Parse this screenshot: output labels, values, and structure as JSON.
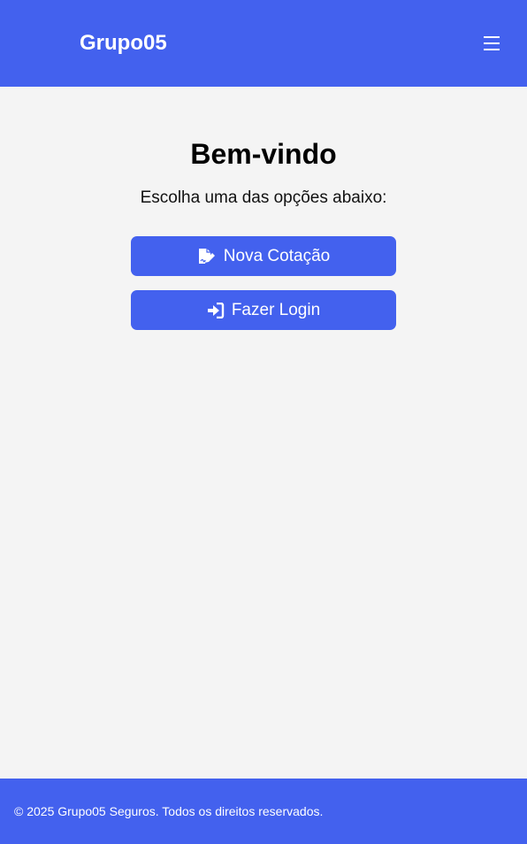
{
  "header": {
    "brand": "Grupo05",
    "menu_icon": "hamburger-menu-icon",
    "background_color": "#4361ee"
  },
  "main": {
    "title": "Bem-vindo",
    "subtitle": "Escolha uma das opções abaixo:",
    "buttons": [
      {
        "label": "Nova Cotação",
        "icon": "file-signature-icon"
      },
      {
        "label": "Fazer Login",
        "icon": "sign-in-icon"
      }
    ],
    "button_color": "#4361ee"
  },
  "footer": {
    "text": "© 2025 Grupo05 Seguros. Todos os direitos reservados."
  }
}
